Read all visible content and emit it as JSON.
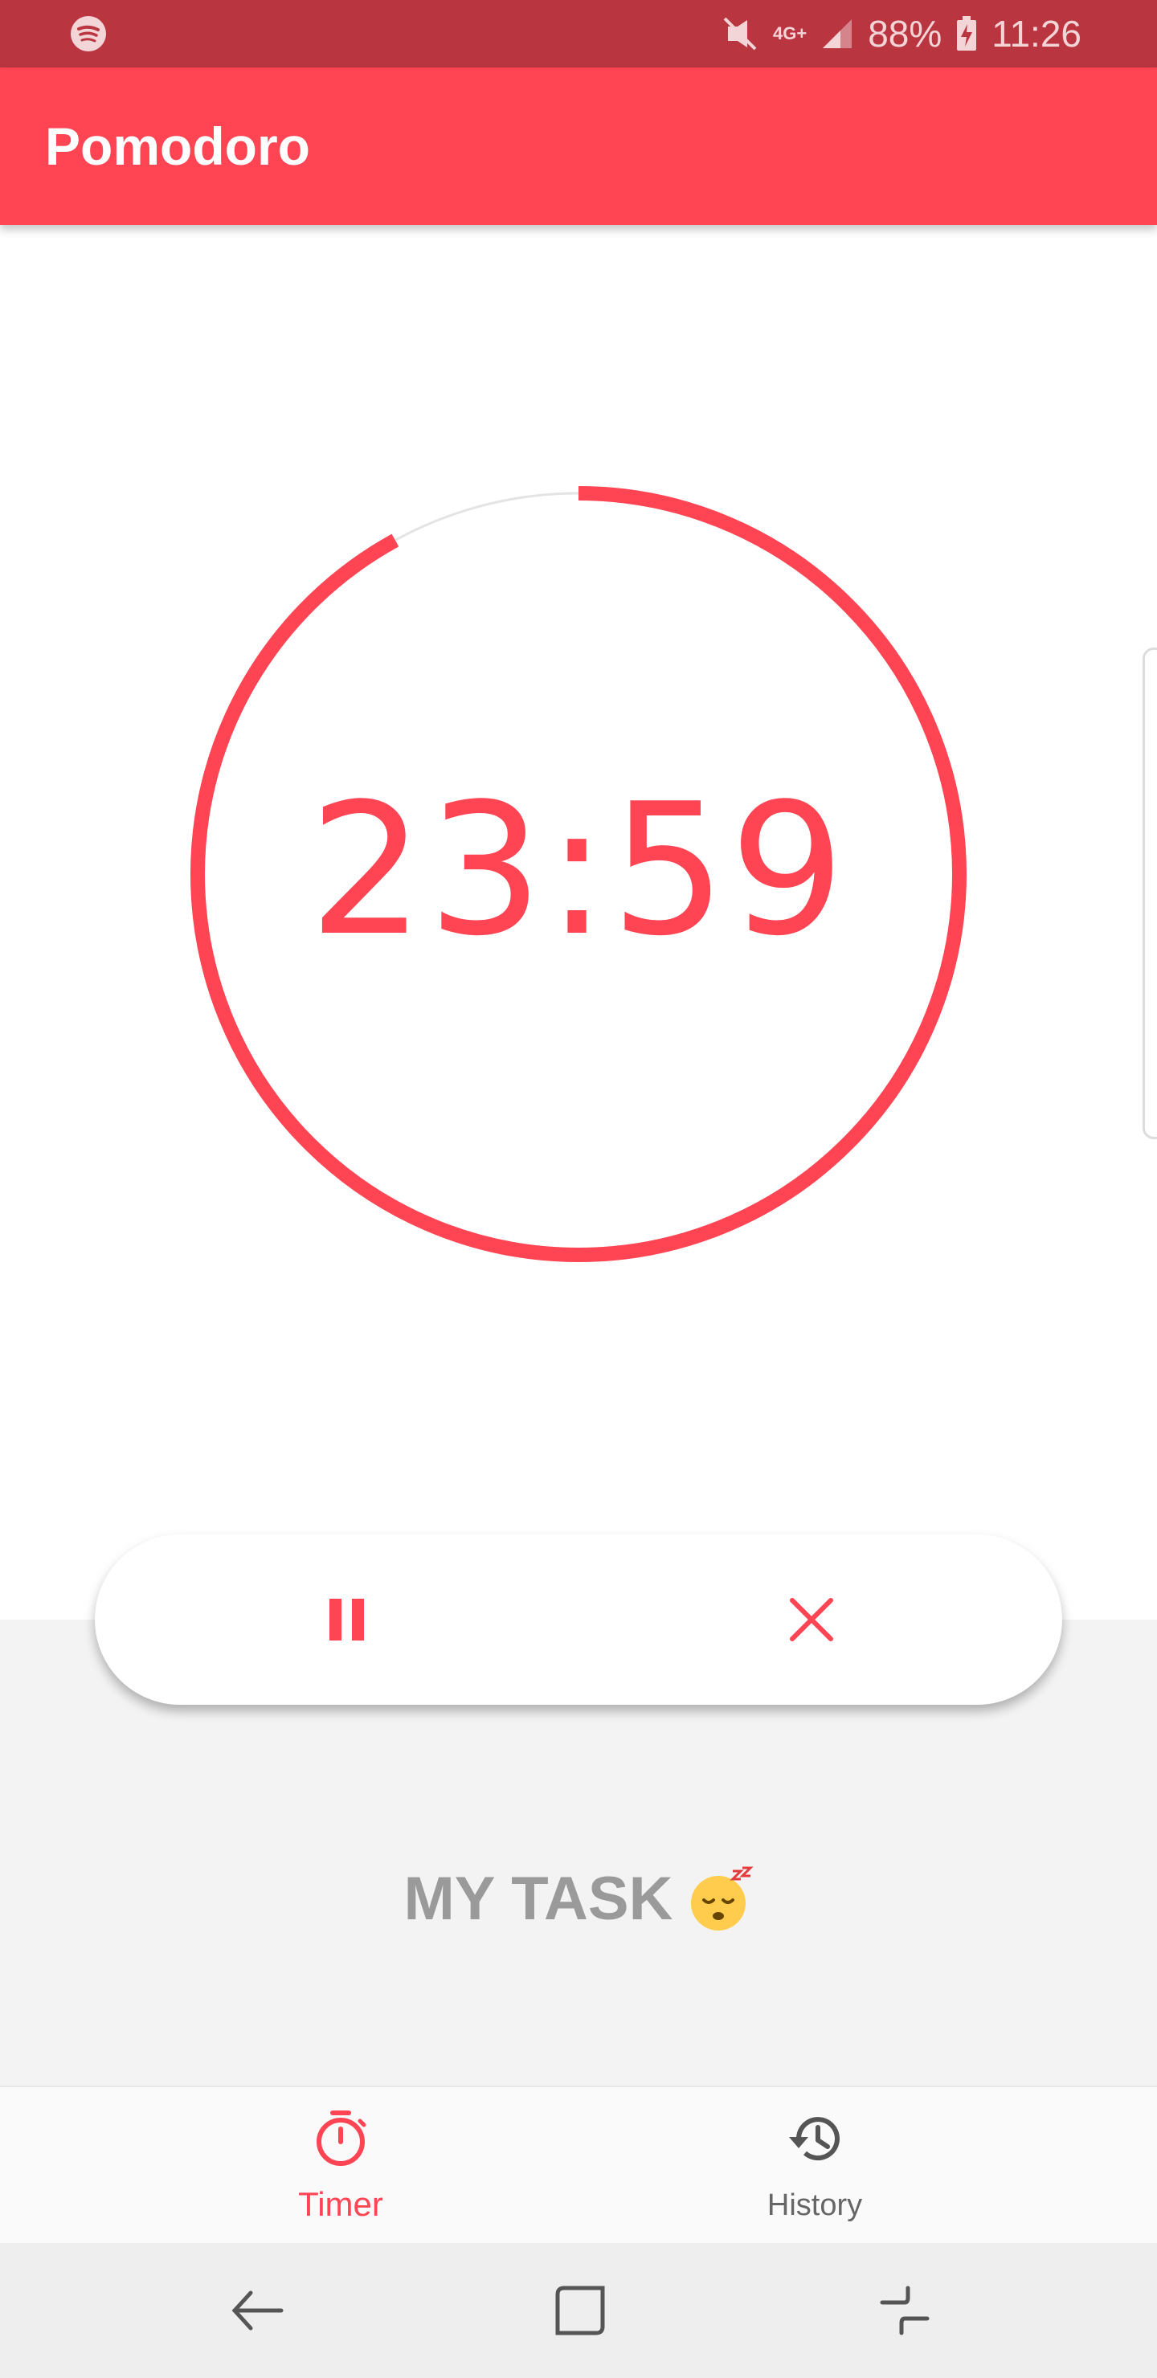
{
  "status_bar": {
    "battery": "88%",
    "time": "11:26",
    "network": "4G+",
    "background_color": "#b93540"
  },
  "app_bar": {
    "title": "Pomodoro",
    "color": "#ff4553"
  },
  "timer": {
    "display": "23:59",
    "progress_fraction": 0.92,
    "accent_color": "#ff4553"
  },
  "controls": {
    "pause_icon": "pause-icon",
    "cancel_icon": "close-icon"
  },
  "task": {
    "name": "MY TASK",
    "emoji": "sleeping-face-emoji"
  },
  "bottom_nav": {
    "items": [
      {
        "label": "Timer",
        "icon": "stopwatch-icon",
        "active": true
      },
      {
        "label": "History",
        "icon": "history-icon",
        "active": false
      }
    ]
  },
  "system_nav": {
    "back_icon": "back-icon",
    "home_icon": "home-icon",
    "recents_icon": "recents-icon"
  }
}
